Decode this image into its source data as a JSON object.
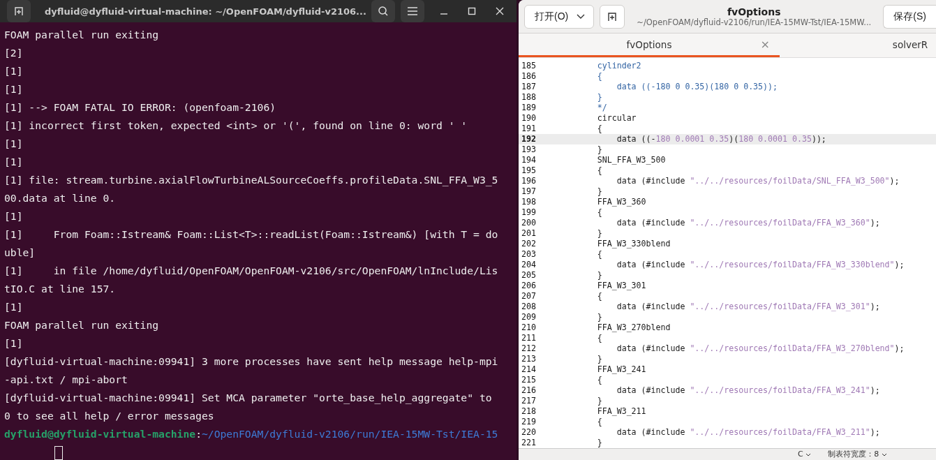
{
  "terminal": {
    "title": "dyfluid@dyfluid-virtual-machine: ~/OpenFOAM/dyfluid-v2106...",
    "lines": [
      "FOAM parallel run exiting",
      "[2]",
      "[1]",
      "[1]",
      "[1] --> FOAM FATAL IO ERROR: (openfoam-2106)",
      "[1] incorrect first token, expected <int> or '(', found on line 0: word ' '",
      "[1]",
      "[1]",
      "[1] file: stream.turbine.axialFlowTurbineALSourceCoeffs.profileData.SNL_FFA_W3_5",
      "00.data at line 0.",
      "[1]",
      "[1]     From Foam::Istream& Foam::List<T>::readList(Foam::Istream&) [with T = do",
      "uble]",
      "[1]     in file /home/dyfluid/OpenFOAM/OpenFOAM-v2106/src/OpenFOAM/lnInclude/Lis",
      "tIO.C at line 157.",
      "[1]",
      "FOAM parallel run exiting",
      "[1]",
      "[dyfluid-virtual-machine:09941] 3 more processes have sent help message help-mpi",
      "-api.txt / mpi-abort",
      "[dyfluid-virtual-machine:09941] Set MCA parameter \"orte_base_help_aggregate\" to",
      "0 to see all help / error messages"
    ],
    "prompt": {
      "user": "dyfluid@dyfluid-virtual-machine",
      "separator": ":",
      "path": "~/OpenFOAM/dyfluid-v2106/run/IEA-15MW-Tst/IEA-15"
    }
  },
  "editor": {
    "open_button": "打开(O)",
    "title": "fvOptions",
    "subtitle": "~/OpenFOAM/dyfluid-v2106/run/IEA-15MW-Tst/IEA-15MW...",
    "save_button": "保存(S)",
    "tabs": [
      {
        "label": "fvOptions",
        "selected": true,
        "close": "×"
      },
      {
        "label": "solverR",
        "selected": false
      }
    ],
    "lines": [
      {
        "number": "185",
        "current": false,
        "segments": [
          {
            "kind": "comment",
            "text": "            cylinder2"
          }
        ]
      },
      {
        "number": "186",
        "current": false,
        "segments": [
          {
            "kind": "comment",
            "text": "            {"
          }
        ]
      },
      {
        "number": "187",
        "current": false,
        "segments": [
          {
            "kind": "comment",
            "text": "                data ((-180 0 0.35)(180 0 0.35));"
          }
        ]
      },
      {
        "number": "188",
        "current": false,
        "segments": [
          {
            "kind": "comment",
            "text": "            }"
          }
        ]
      },
      {
        "number": "189",
        "current": false,
        "segments": [
          {
            "kind": "comment",
            "text": "            */"
          }
        ]
      },
      {
        "number": "190",
        "current": false,
        "segments": [
          {
            "kind": "plain",
            "text": "            circular"
          }
        ]
      },
      {
        "number": "191",
        "current": false,
        "segments": [
          {
            "kind": "plain",
            "text": "            {"
          }
        ]
      },
      {
        "number": "192",
        "current": true,
        "segments": [
          {
            "kind": "plain",
            "text": "                data ((-"
          },
          {
            "kind": "number",
            "text": "180 0.0001 0.35"
          },
          {
            "kind": "plain",
            "text": ")("
          },
          {
            "kind": "number",
            "text": "180 0.0001 0.35"
          },
          {
            "kind": "plain",
            "text": "));"
          }
        ]
      },
      {
        "number": "193",
        "current": false,
        "segments": [
          {
            "kind": "plain",
            "text": "            }"
          }
        ]
      },
      {
        "number": "194",
        "current": false,
        "segments": [
          {
            "kind": "plain",
            "text": "            SNL_FFA_W3_500"
          }
        ]
      },
      {
        "number": "195",
        "current": false,
        "segments": [
          {
            "kind": "plain",
            "text": "            {"
          }
        ]
      },
      {
        "number": "196",
        "current": false,
        "segments": [
          {
            "kind": "plain",
            "text": "                data (#include "
          },
          {
            "kind": "string",
            "text": "\"../../resources/foilData/SNL_FFA_W3_500\""
          },
          {
            "kind": "plain",
            "text": ");"
          }
        ]
      },
      {
        "number": "197",
        "current": false,
        "segments": [
          {
            "kind": "plain",
            "text": "            }"
          }
        ]
      },
      {
        "number": "198",
        "current": false,
        "segments": [
          {
            "kind": "plain",
            "text": "            FFA_W3_360"
          }
        ]
      },
      {
        "number": "199",
        "current": false,
        "segments": [
          {
            "kind": "plain",
            "text": "            {"
          }
        ]
      },
      {
        "number": "200",
        "current": false,
        "segments": [
          {
            "kind": "plain",
            "text": "                data (#include "
          },
          {
            "kind": "string",
            "text": "\"../../resources/foilData/FFA_W3_360\""
          },
          {
            "kind": "plain",
            "text": ");"
          }
        ]
      },
      {
        "number": "201",
        "current": false,
        "segments": [
          {
            "kind": "plain",
            "text": "            }"
          }
        ]
      },
      {
        "number": "202",
        "current": false,
        "segments": [
          {
            "kind": "plain",
            "text": "            FFA_W3_330blend"
          }
        ]
      },
      {
        "number": "203",
        "current": false,
        "segments": [
          {
            "kind": "plain",
            "text": "            {"
          }
        ]
      },
      {
        "number": "204",
        "current": false,
        "segments": [
          {
            "kind": "plain",
            "text": "                data (#include "
          },
          {
            "kind": "string",
            "text": "\"../../resources/foilData/FFA_W3_330blend\""
          },
          {
            "kind": "plain",
            "text": ");"
          }
        ]
      },
      {
        "number": "205",
        "current": false,
        "segments": [
          {
            "kind": "plain",
            "text": "            }"
          }
        ]
      },
      {
        "number": "206",
        "current": false,
        "segments": [
          {
            "kind": "plain",
            "text": "            FFA_W3_301"
          }
        ]
      },
      {
        "number": "207",
        "current": false,
        "segments": [
          {
            "kind": "plain",
            "text": "            {"
          }
        ]
      },
      {
        "number": "208",
        "current": false,
        "segments": [
          {
            "kind": "plain",
            "text": "                data (#include "
          },
          {
            "kind": "string",
            "text": "\"../../resources/foilData/FFA_W3_301\""
          },
          {
            "kind": "plain",
            "text": ");"
          }
        ]
      },
      {
        "number": "209",
        "current": false,
        "segments": [
          {
            "kind": "plain",
            "text": "            }"
          }
        ]
      },
      {
        "number": "210",
        "current": false,
        "segments": [
          {
            "kind": "plain",
            "text": "            FFA_W3_270blend"
          }
        ]
      },
      {
        "number": "211",
        "current": false,
        "segments": [
          {
            "kind": "plain",
            "text": "            {"
          }
        ]
      },
      {
        "number": "212",
        "current": false,
        "segments": [
          {
            "kind": "plain",
            "text": "                data (#include "
          },
          {
            "kind": "string",
            "text": "\"../../resources/foilData/FFA_W3_270blend\""
          },
          {
            "kind": "plain",
            "text": ");"
          }
        ]
      },
      {
        "number": "213",
        "current": false,
        "segments": [
          {
            "kind": "plain",
            "text": "            }"
          }
        ]
      },
      {
        "number": "214",
        "current": false,
        "segments": [
          {
            "kind": "plain",
            "text": "            FFA_W3_241"
          }
        ]
      },
      {
        "number": "215",
        "current": false,
        "segments": [
          {
            "kind": "plain",
            "text": "            {"
          }
        ]
      },
      {
        "number": "216",
        "current": false,
        "segments": [
          {
            "kind": "plain",
            "text": "                data (#include "
          },
          {
            "kind": "string",
            "text": "\"../../resources/foilData/FFA_W3_241\""
          },
          {
            "kind": "plain",
            "text": ");"
          }
        ]
      },
      {
        "number": "217",
        "current": false,
        "segments": [
          {
            "kind": "plain",
            "text": "            }"
          }
        ]
      },
      {
        "number": "218",
        "current": false,
        "segments": [
          {
            "kind": "plain",
            "text": "            FFA_W3_211"
          }
        ]
      },
      {
        "number": "219",
        "current": false,
        "segments": [
          {
            "kind": "plain",
            "text": "            {"
          }
        ]
      },
      {
        "number": "220",
        "current": false,
        "segments": [
          {
            "kind": "plain",
            "text": "                data (#include "
          },
          {
            "kind": "string",
            "text": "\"../../resources/foilData/FFA_W3_211\""
          },
          {
            "kind": "plain",
            "text": ");"
          }
        ]
      },
      {
        "number": "221",
        "current": false,
        "segments": [
          {
            "kind": "plain",
            "text": "            }"
          }
        ]
      }
    ],
    "status_bar": {
      "language": "C",
      "tab_width": "制表符宽度：8"
    }
  }
}
